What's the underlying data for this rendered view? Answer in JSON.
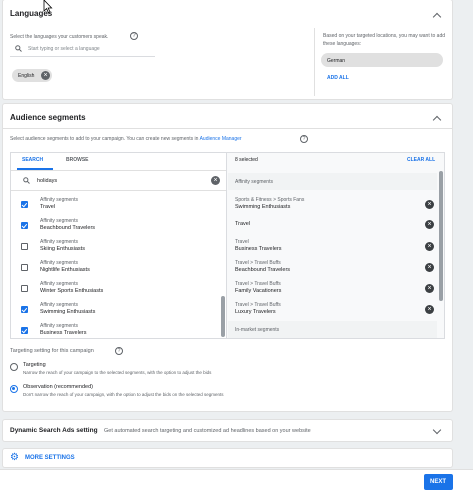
{
  "languages": {
    "title": "Languages",
    "prompt": "Select the languages your customers speak.",
    "search_placeholder": "Start typing or select a language",
    "chip": "English",
    "hint": "Based on your targeted locations, you may want to add these languages:",
    "suggested": "German",
    "add_all": "ADD ALL"
  },
  "audience": {
    "title": "Audience segments",
    "prompt": "Select audience segments to add to your campaign. You can create new segments in",
    "prompt_link": "Audience Manager",
    "tabs": [
      "SEARCH",
      "BROWSE"
    ],
    "search_value": "holidays",
    "results": [
      {
        "category": "Affinity segments",
        "name": "Travel",
        "checked": true
      },
      {
        "category": "Affinity segments",
        "name": "Beachbound Travelers",
        "checked": true
      },
      {
        "category": "Affinity segments",
        "name": "Skiing Enthusiasts",
        "checked": false
      },
      {
        "category": "Affinity segments",
        "name": "Nightlife Enthusiasts",
        "checked": false
      },
      {
        "category": "Affinity segments",
        "name": "Winter Sports Enthusiasts",
        "checked": false
      },
      {
        "category": "Affinity segments",
        "name": "Swimming Enthusiasts",
        "checked": true
      },
      {
        "category": "Affinity segments",
        "name": "Business Travelers",
        "checked": true
      }
    ],
    "selected_count": "8 selected",
    "clear_all": "CLEAR ALL",
    "selected_group_1": "Affinity segments",
    "selected": [
      {
        "path": "Sports & Fitness > Sports Fans",
        "name": "Swimming Enthusiasts"
      },
      {
        "path": "",
        "name": "Travel"
      },
      {
        "path": "Travel",
        "name": "Business Travelers"
      },
      {
        "path": "Travel > Travel Buffs",
        "name": "Beachbound Travelers"
      },
      {
        "path": "Travel > Travel Buffs",
        "name": "Family Vacationers"
      },
      {
        "path": "Travel > Travel Buffs",
        "name": "Luxury Travelers"
      }
    ],
    "selected_group_2": "In-market segments",
    "targeting_label": "Targeting setting for this campaign",
    "options": [
      {
        "title": "Targeting",
        "desc": "Narrow the reach of your campaign to the selected segments, with the option to adjust the bids",
        "selected": false
      },
      {
        "title": "Observation (recommended)",
        "desc": "Don't narrow the reach of your campaign, with the option to adjust the bids on the selected segments",
        "selected": true
      }
    ]
  },
  "dsa": {
    "title": "Dynamic Search Ads setting",
    "desc": "Get automated search targeting and customized ad headlines based on your website"
  },
  "more_settings": "MORE SETTINGS",
  "next": "NEXT",
  "colors": {
    "accent": "#1a73e8",
    "background": "#eceff1",
    "selected_panel": "#f1f3f4"
  }
}
